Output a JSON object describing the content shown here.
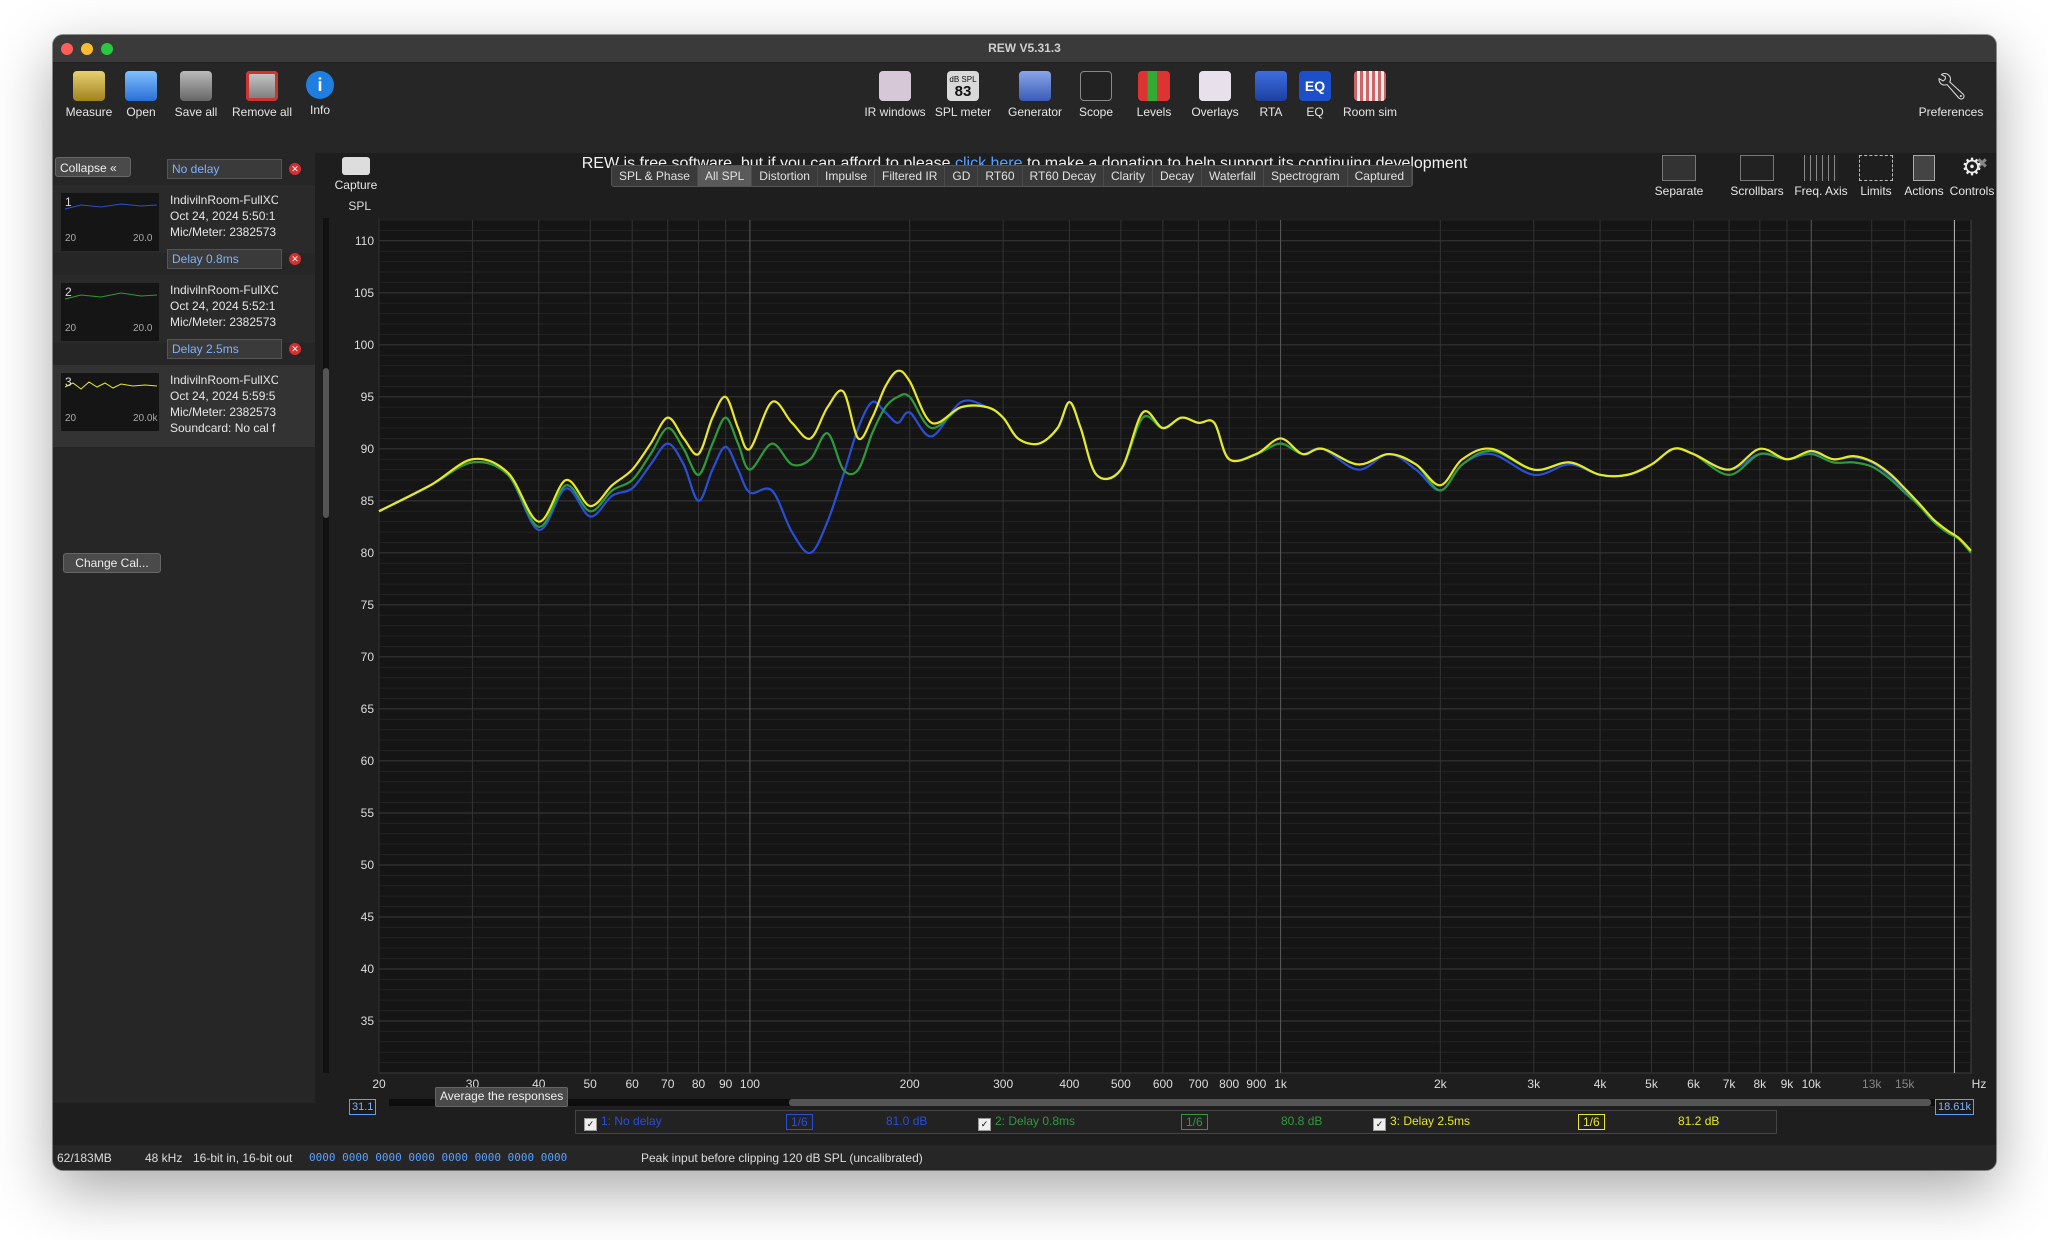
{
  "window": {
    "title": "REW V5.31.3"
  },
  "toolbar": {
    "left": [
      {
        "label": "Measure",
        "icon": "measure-icon"
      },
      {
        "label": "Open",
        "icon": "folder-icon"
      },
      {
        "label": "Save all",
        "icon": "save-icon"
      },
      {
        "label": "Remove all",
        "icon": "remove-icon"
      },
      {
        "label": "Info",
        "icon": "info-icon"
      }
    ],
    "center": [
      {
        "label": "IR windows",
        "icon": "ir-windows-icon"
      },
      {
        "label": "SPL meter",
        "icon": "spl-meter-icon",
        "badge_top": "dB SPL",
        "badge_value": "83"
      },
      {
        "label": "Generator",
        "icon": "generator-icon"
      },
      {
        "label": "Scope",
        "icon": "scope-icon"
      },
      {
        "label": "Levels",
        "icon": "levels-icon"
      },
      {
        "label": "Overlays",
        "icon": "overlays-icon"
      },
      {
        "label": "RTA",
        "icon": "rta-icon"
      },
      {
        "label": "EQ",
        "icon": "eq-icon"
      },
      {
        "label": "Room sim",
        "icon": "room-sim-icon"
      }
    ],
    "preferences": "Preferences"
  },
  "banner": {
    "before": "REW is free software, but if you can afford to please ",
    "link": "click here",
    "after": " to make a donation to help support its continuing development"
  },
  "capture_label": "Capture",
  "tabs": [
    "SPL & Phase",
    "All SPL",
    "Distortion",
    "Impulse",
    "Filtered IR",
    "GD",
    "RT60",
    "RT60 Decay",
    "Clarity",
    "Decay",
    "Waterfall",
    "Spectrogram",
    "Captured"
  ],
  "active_tab": "All SPL",
  "graph_controls": [
    "Separate",
    "Scrollbars",
    "Freq. Axis",
    "Limits",
    "Actions",
    "Controls"
  ],
  "sidebar": {
    "collapse": "Collapse",
    "change_cal": "Change Cal...",
    "thumb_start": "20",
    "measurements": [
      {
        "num": "1",
        "notes": "No delay",
        "name": "IndivilnRoom-FullXC",
        "date": "Oct 24, 2024 5:50:1",
        "mic": "Mic/Meter: 2382573",
        "thumb_end": "20.0",
        "color": "#2a4fd6"
      },
      {
        "num": "2",
        "notes": "Delay 0.8ms",
        "name": "IndivilnRoom-FullXC",
        "date": "Oct 24, 2024 5:52:1",
        "mic": "Mic/Meter: 2382573",
        "thumb_end": "20.0",
        "color": "#2f9a3a"
      },
      {
        "num": "3",
        "notes": "Delay 2.5ms",
        "name": "IndivilnRoom-FullXC",
        "date": "Oct 24, 2024 5:59:5",
        "mic": "Mic/Meter: 2382573",
        "card": "Soundcard: No cal f",
        "thumb_end": "20.0k",
        "color": "#e8e826"
      }
    ]
  },
  "average_button": "Average the responses",
  "range_start": "31.1",
  "range_end": "18.61k",
  "chart_data": {
    "type": "line",
    "ylabel": "SPL",
    "x_unit": "Hz",
    "ylim": [
      30,
      112
    ],
    "xlim": [
      20,
      20000
    ],
    "x_scale": "log",
    "y_ticks": [
      35,
      40,
      45,
      50,
      55,
      60,
      65,
      70,
      75,
      80,
      85,
      90,
      95,
      100,
      105,
      110
    ],
    "x_ticks": [
      {
        "v": 20,
        "l": "20"
      },
      {
        "v": 30,
        "l": "30"
      },
      {
        "v": 40,
        "l": "40"
      },
      {
        "v": 50,
        "l": "50"
      },
      {
        "v": 60,
        "l": "60"
      },
      {
        "v": 70,
        "l": "70"
      },
      {
        "v": 80,
        "l": "80"
      },
      {
        "v": 90,
        "l": "90"
      },
      {
        "v": 100,
        "l": "100"
      },
      {
        "v": 200,
        "l": "200"
      },
      {
        "v": 300,
        "l": "300"
      },
      {
        "v": 400,
        "l": "400"
      },
      {
        "v": 500,
        "l": "500"
      },
      {
        "v": 600,
        "l": "600"
      },
      {
        "v": 700,
        "l": "700"
      },
      {
        "v": 800,
        "l": "800"
      },
      {
        "v": 900,
        "l": "900"
      },
      {
        "v": 1000,
        "l": "1k"
      },
      {
        "v": 2000,
        "l": "2k"
      },
      {
        "v": 3000,
        "l": "3k"
      },
      {
        "v": 4000,
        "l": "4k"
      },
      {
        "v": 5000,
        "l": "5k"
      },
      {
        "v": 6000,
        "l": "6k"
      },
      {
        "v": 7000,
        "l": "7k"
      },
      {
        "v": 8000,
        "l": "8k"
      },
      {
        "v": 9000,
        "l": "9k"
      },
      {
        "v": 10000,
        "l": "10k"
      },
      {
        "v": 13000,
        "l": "13k"
      },
      {
        "v": 15000,
        "l": "15k"
      }
    ],
    "x": [
      20,
      25,
      30,
      35,
      40,
      45,
      50,
      55,
      60,
      65,
      70,
      75,
      80,
      85,
      90,
      95,
      100,
      110,
      120,
      130,
      140,
      150,
      160,
      170,
      180,
      190,
      200,
      220,
      250,
      280,
      300,
      320,
      350,
      380,
      400,
      420,
      450,
      500,
      550,
      600,
      650,
      700,
      750,
      800,
      900,
      1000,
      1100,
      1200,
      1400,
      1600,
      1800,
      2000,
      2200,
      2500,
      3000,
      3500,
      4000,
      4500,
      5000,
      5500,
      6000,
      7000,
      8000,
      9000,
      10000,
      11000,
      12000,
      13000,
      14000,
      15000,
      16000,
      17000,
      18000,
      19000,
      20000
    ],
    "series": [
      {
        "name": "1: No delay",
        "color": "#2a4fd6",
        "smoothing": "1/6",
        "level": "81.0 dB",
        "values": [
          84,
          86.5,
          88.7,
          87.5,
          82.2,
          86.2,
          83.5,
          85.5,
          86.2,
          88.5,
          90.5,
          88.5,
          85,
          88,
          90.2,
          88,
          85.8,
          86,
          82,
          80,
          83,
          87.5,
          92,
          94.5,
          93.5,
          92.5,
          93.5,
          91.2,
          94.5,
          94,
          93,
          91,
          90.5,
          92,
          94.5,
          92,
          87.5,
          88,
          93,
          92,
          93,
          92.5,
          92.5,
          89,
          89.5,
          90.5,
          89.5,
          90,
          88,
          89.5,
          88,
          86,
          88.5,
          89.5,
          87.5,
          88.5,
          87.5,
          87.5,
          88.5,
          90,
          89.5,
          88,
          89.5,
          89,
          89.7,
          89,
          89.2,
          88.7,
          87.5,
          86,
          84.5,
          83,
          82,
          81.3,
          80
        ]
      },
      {
        "name": "2: Delay 0.8ms",
        "color": "#2f9a3a",
        "smoothing": "1/6",
        "level": "80.8 dB",
        "values": [
          84,
          86.5,
          88.7,
          87.5,
          82.5,
          86.5,
          84,
          86,
          87,
          89.5,
          92,
          90,
          87.5,
          90.5,
          93,
          90.5,
          88,
          90.5,
          88.5,
          89,
          91.5,
          88,
          88,
          91.5,
          94,
          95,
          95,
          92,
          94,
          94,
          93,
          91,
          90.5,
          92,
          94.5,
          92,
          87.5,
          88,
          93,
          92,
          93,
          92.5,
          92.5,
          89,
          89.5,
          90.5,
          89.5,
          90,
          88.5,
          89.5,
          88.5,
          86,
          88.5,
          89.8,
          88,
          88.7,
          87.5,
          87.5,
          88.5,
          90,
          89.5,
          87.5,
          89.5,
          89,
          89.5,
          88.7,
          88.7,
          88.3,
          87.2,
          85.8,
          84.5,
          83,
          82,
          81.3,
          80
        ]
      },
      {
        "name": "3: Delay 2.5ms",
        "color": "#e8e826",
        "smoothing": "1/6",
        "level": "81.2 dB",
        "values": [
          84,
          86.5,
          89,
          87.7,
          83,
          87,
          84.5,
          86.5,
          88,
          90.5,
          93,
          91,
          89.5,
          93,
          95,
          92,
          90,
          94.5,
          92.5,
          91,
          94,
          95.5,
          91,
          93,
          96,
          97.5,
          96.5,
          92.5,
          94,
          94,
          93,
          91,
          90.5,
          92,
          94.5,
          92,
          87.5,
          88,
          93.5,
          92,
          93,
          92.5,
          92.5,
          89,
          89.5,
          91,
          89.5,
          90,
          88.5,
          89.5,
          88.5,
          86.5,
          89,
          90,
          88,
          88.7,
          87.5,
          87.5,
          88.5,
          90,
          89.5,
          88,
          90,
          89,
          89.8,
          89,
          89.3,
          88.8,
          87.7,
          86.2,
          84.7,
          83.2,
          82.2,
          81.4,
          80.2
        ]
      }
    ]
  },
  "status": {
    "memory": "62/183MB",
    "rate": "48 kHz",
    "bits": "16-bit in, 16-bit out",
    "meters": "0000 0000  0000 0000  0000 0000  0000 0000",
    "peak": "Peak input before clipping 120 dB SPL (uncalibrated)"
  },
  "colors": {
    "background": "#1e1e1e",
    "grid": "#3a3a3a",
    "accent": "#5aa0ff"
  }
}
